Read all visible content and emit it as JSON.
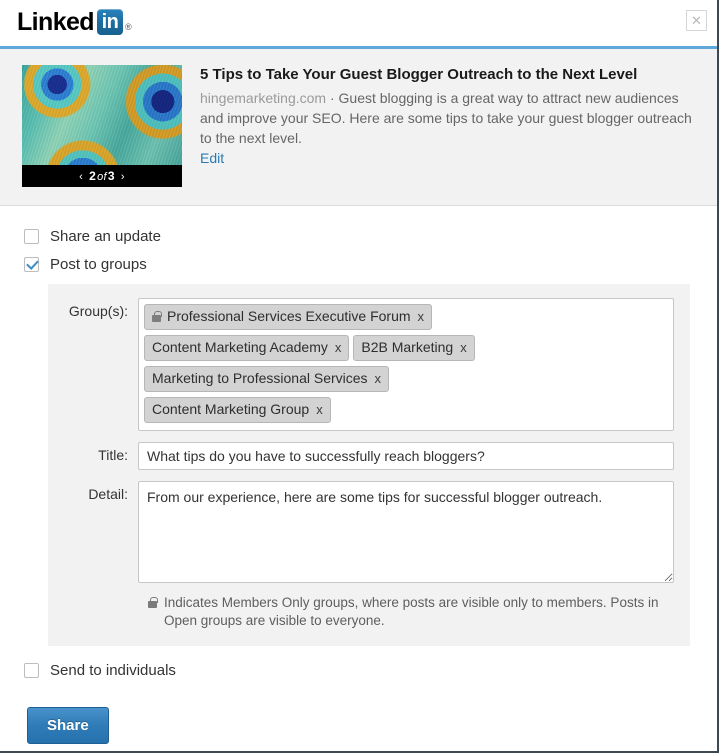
{
  "header": {
    "logo_word": "Linked",
    "logo_box": "in",
    "logo_registered": "®",
    "close_label": "✕"
  },
  "preview": {
    "title": "5 Tips to Take Your Guest Blogger Outreach to the Next Level",
    "domain": "hingemarketing.com",
    "separator": "·",
    "description": "Guest blogging is a great way to attract new audiences and improve your SEO. Here are some tips to take your guest blogger outreach to the next level.",
    "edit_label": "Edit",
    "nav": {
      "prev": "‹",
      "next": "›",
      "current": "2",
      "of": "of",
      "total": "3"
    }
  },
  "options": {
    "share_update": {
      "label": "Share an update",
      "checked": false
    },
    "post_to_groups": {
      "label": "Post to groups",
      "checked": true
    },
    "send_to_individuals": {
      "label": "Send to individuals",
      "checked": false
    }
  },
  "group_form": {
    "groups_label": "Group(s):",
    "tags": [
      {
        "name": "Professional Services Executive Forum",
        "members_only": true,
        "remove": "x"
      },
      {
        "name": "Content Marketing Academy",
        "members_only": false,
        "remove": "x"
      },
      {
        "name": "B2B Marketing",
        "members_only": false,
        "remove": "x"
      },
      {
        "name": "Marketing to Professional Services",
        "members_only": false,
        "remove": "x"
      },
      {
        "name": "Content Marketing Group",
        "members_only": false,
        "remove": "x"
      }
    ],
    "title_label": "Title:",
    "title_value": "What tips do you have to successfully reach bloggers?",
    "detail_label": "Detail:",
    "detail_value": "From our experience, here are some tips for successful blogger outreach.",
    "hint": "Indicates Members Only groups, where posts are visible only to members. Posts in Open groups are visible to everyone."
  },
  "footer": {
    "share_label": "Share"
  },
  "colors": {
    "accent_blue": "#2f7cb8",
    "rule_blue": "#5fa8d9",
    "link_blue": "#2a7ab0",
    "panel_gray": "#f2f2f2",
    "tag_gray": "#d3d3d3"
  }
}
